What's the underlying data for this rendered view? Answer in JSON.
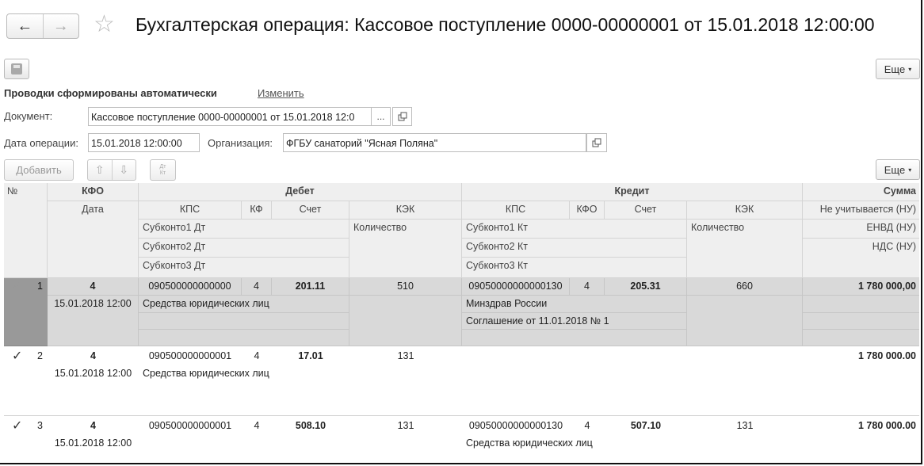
{
  "window": {
    "title": "Бухгалтерская операция: Кассовое поступление 0000-00000001 от 15.01.2018 12:00:00",
    "back_icon": "←",
    "forward_icon": "→",
    "star_icon": "☆"
  },
  "toolbar": {
    "more_label": "Еще",
    "more_arrow": "▾"
  },
  "auto": {
    "text": "Проводки сформированы автоматически",
    "change_label": "Изменить"
  },
  "form": {
    "document_label": "Документ:",
    "document_value": "Кассовое поступление 0000-00000001 от 15.01.2018 12:0",
    "select_dots": "...",
    "date_label": "Дата операции:",
    "date_value": "15.01.2018 12:00:00",
    "org_label": "Организация:",
    "org_value": "ФГБУ санаторий \"Ясная Поляна\""
  },
  "table_toolbar": {
    "add_label": "Добавить",
    "up_icon": "⇧",
    "down_icon": "⇩",
    "dtkt_top": "Дт",
    "dtkt_bottom": "Кт",
    "more_label": "Еще"
  },
  "header": {
    "num": "№",
    "kfo": "КФО",
    "debit": "Дебет",
    "credit": "Кредит",
    "sum": "Сумма",
    "date": "Дата",
    "kps_d": "КПС",
    "kf_d": "КФ",
    "account_d": "Счет",
    "kek_d": "КЭК",
    "kps_k": "КПС",
    "kfo_k": "КФО",
    "account_k": "Счет",
    "kek_k": "КЭК",
    "not_counted": "Не учитывается (НУ)",
    "sub1_d": "Субконто1 Дт",
    "sub2_d": "Субконто2 Дт",
    "sub3_d": "Субконто3 Дт",
    "qty_d": "Количество",
    "sub1_k": "Субконто1 Кт",
    "sub2_k": "Субконто2 Кт",
    "sub3_k": "Субконто3 Кт",
    "qty_k": "Количество",
    "envd": "ЕНВД (НУ)",
    "nds": "НДС (НУ)"
  },
  "rows": [
    {
      "check": "✓",
      "num": "1",
      "kfo": "4",
      "date": "15.01.2018 12:00",
      "kps_d": "090500000000000",
      "kf_d": "4",
      "account_d": "201.11",
      "kek_d": "510",
      "sub1_d": "Средства юридических лиц",
      "sub2_d": "",
      "sub3_d": "",
      "kps_k": "09050000000000130",
      "kfo_k": "4",
      "account_k": "205.31",
      "kek_k": "660",
      "sub1_k": "Минздрав России",
      "sub2_k": "Соглашение от 11.01.2018 № 1",
      "sub3_k": "",
      "sum": "1 780 000,00"
    },
    {
      "check": "✓",
      "num": "2",
      "kfo": "4",
      "date": "15.01.2018 12:00",
      "kps_d": "090500000000001",
      "kf_d": "4",
      "account_d": "17.01",
      "kek_d": "131",
      "sub1_d": "Средства юридических лиц",
      "kps_k": "",
      "kfo_k": "",
      "account_k": "",
      "kek_k": "",
      "sub1_k": "",
      "sum": "1 780 000.00"
    },
    {
      "check": "✓",
      "num": "3",
      "kfo": "4",
      "date": "15.01.2018 12:00",
      "kps_d": "090500000000001",
      "kf_d": "4",
      "account_d": "508.10",
      "kek_d": "131",
      "sub1_d": "",
      "kps_k": "09050000000000130",
      "kfo_k": "4",
      "account_k": "507.10",
      "kek_k": "131",
      "sub1_k": "Средства юридических лиц",
      "sum": "1 780 000.00"
    }
  ]
}
